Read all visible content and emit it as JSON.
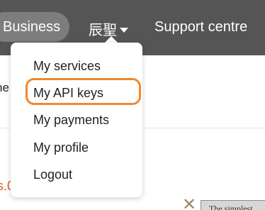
{
  "nav": {
    "business_label": "Business",
    "user_label": "辰聖",
    "support_label": "Support centre"
  },
  "user_menu": {
    "items": [
      {
        "label": "My services"
      },
      {
        "label": "My API keys",
        "highlighted": true
      },
      {
        "label": "My payments"
      },
      {
        "label": "My profile"
      },
      {
        "label": "Logout"
      }
    ]
  },
  "background": {
    "fragment_text": "ne",
    "fragment_orange": "s.0",
    "banner_text": "The simplest"
  },
  "colors": {
    "topbar": "#555555",
    "pill": "#7d7d7d",
    "highlight_ring": "#f0892c",
    "orange_text": "#d8601c"
  }
}
